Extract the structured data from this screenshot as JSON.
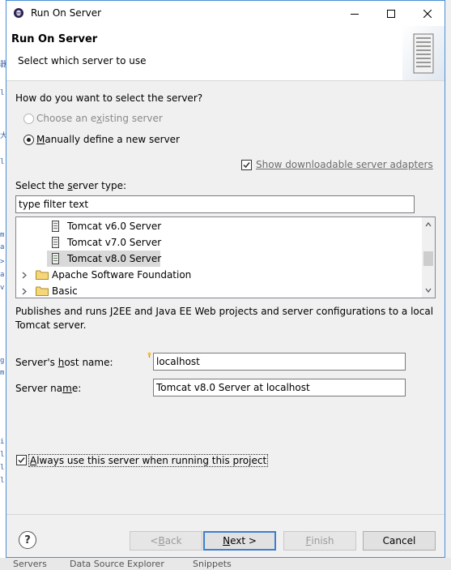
{
  "window": {
    "title": "Run On Server"
  },
  "header": {
    "title": "Run On Server",
    "subtitle": "Select which server to use"
  },
  "question": "How do you want to select the server?",
  "options": {
    "existing": {
      "label": "Choose an existing server",
      "selected": false,
      "enabled": false
    },
    "manual": {
      "label": "Manually define a new server",
      "selected": true,
      "enabled": true
    }
  },
  "downloadable": {
    "label": "Show downloadable server adapters",
    "checked": true
  },
  "server_type": {
    "label": "Select the server type:",
    "filter_value": "type filter text",
    "tree": [
      {
        "label": "Tomcat v6.0 Server",
        "kind": "server",
        "selected": false
      },
      {
        "label": "Tomcat v7.0 Server",
        "kind": "server",
        "selected": false
      },
      {
        "label": "Tomcat v8.0 Server",
        "kind": "server",
        "selected": true
      },
      {
        "label": "Apache Software Foundation",
        "kind": "folder",
        "selected": false
      },
      {
        "label": "Basic",
        "kind": "folder",
        "selected": false
      }
    ]
  },
  "description": {
    "line1": "Publishes and runs J2EE and Java EE Web projects and server configurations to a local",
    "line2": "Tomcat server."
  },
  "host": {
    "label": "Server's host name:",
    "value": "localhost"
  },
  "name": {
    "label": "Server name:",
    "value": "Tomcat v8.0 Server at localhost"
  },
  "always": {
    "label": "Always use this server when running this project",
    "checked": true
  },
  "buttons": {
    "help": "?",
    "back": "< Back",
    "next": "Next >",
    "finish": "Finish",
    "cancel": "Cancel"
  },
  "background": {
    "bottom_tabs": [
      "Servers",
      "Data Source Explorer",
      "Snippets"
    ]
  },
  "colors": {
    "accent": "#3c7fd1",
    "border": "#4a8fd8",
    "selection": "#d9d9d9"
  }
}
